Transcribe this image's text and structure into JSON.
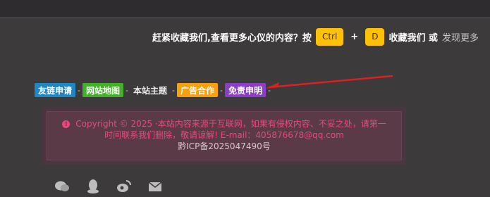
{
  "bookmark": {
    "prompt": "赶紧收藏我们,查看更多心仪的内容？按",
    "key1": "Ctrl",
    "plus": "+",
    "key2": "D",
    "action": "收藏我们 或",
    "discover": "发现更多"
  },
  "links": [
    {
      "label": "友链申请",
      "color": "#1e88c7"
    },
    {
      "label": "网站地图",
      "color": "#43b02a"
    },
    {
      "label": "本站主题",
      "color": ""
    },
    {
      "label": "广告合作",
      "color": "#f5a00c"
    },
    {
      "label": "免责申明",
      "color": "#8a3fc6"
    }
  ],
  "separator": "-",
  "notice": {
    "line1": "Copyright © 2025 ·本站内容来源于互联网，如果有侵权内容、不妥之处，请第一时间联系我们删除，敬请谅解! E-mail：405876678@qq.com",
    "icp": "黔ICP备2025047490号"
  },
  "colors": {
    "arrow": "#e02020",
    "accent": "#ffc107",
    "notice_text": "#e8487a"
  },
  "social_icons": [
    "wechat-icon",
    "qq-icon",
    "weibo-icon",
    "mail-icon"
  ]
}
